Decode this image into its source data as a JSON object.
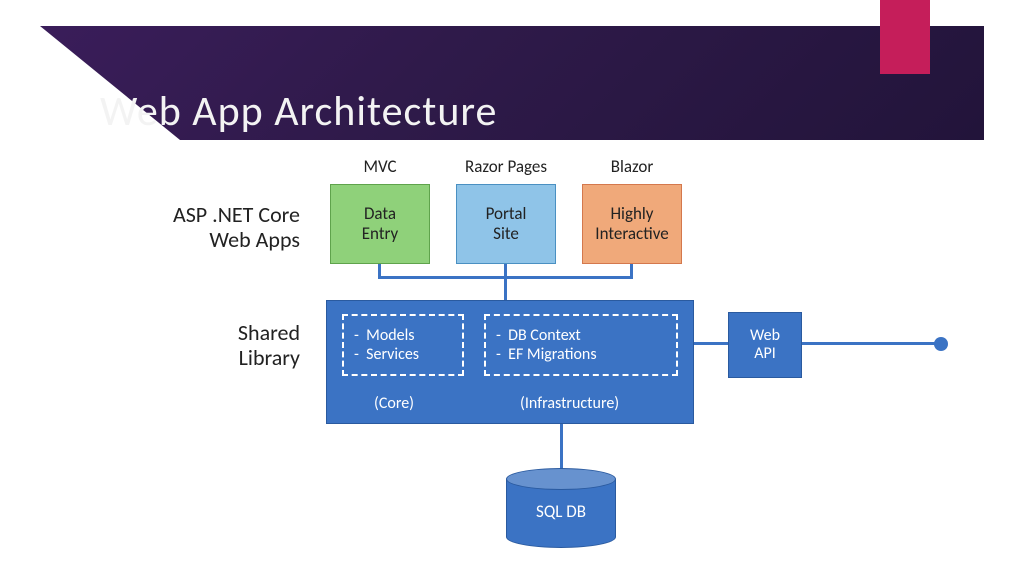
{
  "title": "Web App Architecture",
  "row_labels": {
    "web_apps": "ASP .NET Core\nWeb Apps",
    "shared": "Shared\nLibrary"
  },
  "techs": [
    "MVC",
    "Razor Pages",
    "Blazor"
  ],
  "apps": [
    {
      "label": "Data\nEntry"
    },
    {
      "label": "Portal\nSite"
    },
    {
      "label": "Highly\nInteractive"
    }
  ],
  "shared_library": {
    "core": {
      "items": [
        "Models",
        "Services"
      ],
      "caption": "(Core)"
    },
    "infra": {
      "items": [
        "DB Context",
        "EF Migrations"
      ],
      "caption": "(Infrastructure)"
    }
  },
  "web_api": "Web\nAPI",
  "db": "SQL DB"
}
